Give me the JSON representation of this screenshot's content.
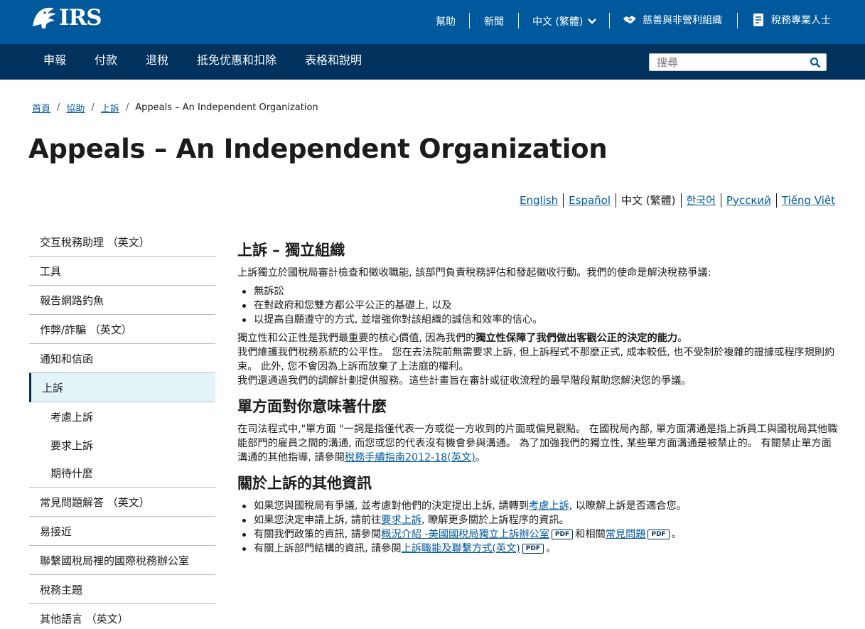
{
  "header": {
    "logo_text": "IRS",
    "utility": {
      "help": "幫助",
      "news": "新聞",
      "language": "中文 (繁體)",
      "charities": "慈善與非營利組織",
      "tax_pros": "稅務專業人士"
    }
  },
  "nav": {
    "items": [
      "申報",
      "付款",
      "退稅",
      "抵免优惠和扣除",
      "表格和說明"
    ],
    "search_placeholder": "搜尋"
  },
  "breadcrumb": {
    "items": [
      "首頁",
      "協助",
      "上訴"
    ],
    "current": "Appeals – An Independent Organization"
  },
  "page_title": "Appeals – An Independent Organization",
  "languages": {
    "items": [
      "English",
      "Español",
      "中文 (繁體)",
      "한국어",
      "Русский",
      "Tiếng Việt"
    ]
  },
  "sidebar": {
    "items": [
      "交互稅務助理 （英文）",
      "工具",
      "報告網路釣魚",
      "作弊/詐騙 （英文）",
      "通知和信函",
      "上訴",
      "常見問題解答 （英文）",
      "易接近",
      "聯繫國稅局裡的國際稅務辦公室",
      "稅務主題",
      "其他語言 （英文）"
    ],
    "subitems": [
      "考慮上訴",
      "要求上訴",
      "期待什麼"
    ]
  },
  "content": {
    "section1": {
      "heading": "上訴 – 獨立組織",
      "intro": "上訴獨立於國稅局審計檢查和徵收職能, 該部門負責稅務評估和發起徵收行動。我們的使命是解決稅務爭議:",
      "bullets": [
        "無訴訟",
        "在對政府和您雙方都公平公正的基礎上, 以及",
        "以提高自願遵守的方式, 並增強你對該組織的誠信和效率的信心。"
      ],
      "p1_lead": "獨立性和公正性是我們最重要的核心價值, 因為我們的",
      "p1_bold": "獨立性保障了我們做出客觀公正的決定的能力",
      "p1_end": "。",
      "p2": "我們維護我們稅務系統的公平性。 您在去法院前無需要求上訴, 但上訴程式不那麼正式, 成本較低, 也不受制於複雜的證據或程序規則約束。 此外, 您不會因為上訴而放棄了上法庭的權利。",
      "p3": "我們還通過我們的調解計劃提供服務。這些計畫旨在審計或征收流程的最早階段幫助您解決您的爭議。"
    },
    "section2": {
      "heading": "單方面對你意味著什麼",
      "text": "在司法程式中,\"單方面 \"一詞是指僅代表一方或從一方收到的片面或偏見觀點。 在國稅局內部, 單方面溝通是指上訴員工與國稅局其他職能部門的雇員之間的溝通, 而您或您的代表沒有機會參與溝通。 為了加強我們的獨立性, 某些單方面溝通是被禁止的。 有關禁止單方面溝通的其他指導, 請參閱",
      "link1": "稅務手續指南2012-18",
      "link2": "(英文)",
      "end": "。"
    },
    "section3": {
      "heading": "關於上訴的其他資訊",
      "b1_pre": "如果您與國稅局有爭議, 並考慮對他們的決定提出上訴, 請轉到",
      "b1_link": "考慮上訴",
      "b1_post": ", 以瞭解上訴是否適合您。",
      "b2_pre": "如果您決定申請上訴, 請前往",
      "b2_link": "要求上訴",
      "b2_post": ", 瞭解更多關於上訴程序的資訊。",
      "b3_pre": "有關我們政策的資訊, 請參閱",
      "b3_link": "概況介紹 -美國國稅局獨立上訴辦公室",
      "b3_mid": "和相關",
      "b3_link2": "常見問題",
      "b3_end": "。",
      "b4_pre": "有關上訴部門結構的資訊, 請參閱",
      "b4_link": "上訴職能及聯繫方式(英文)",
      "b4_end": "。",
      "pdf_label": "PDF"
    }
  },
  "colors": {
    "header_blue": "#00599c",
    "nav_navy": "#00325d",
    "link": "#00599c",
    "active_bg": "#e2f4f7"
  }
}
